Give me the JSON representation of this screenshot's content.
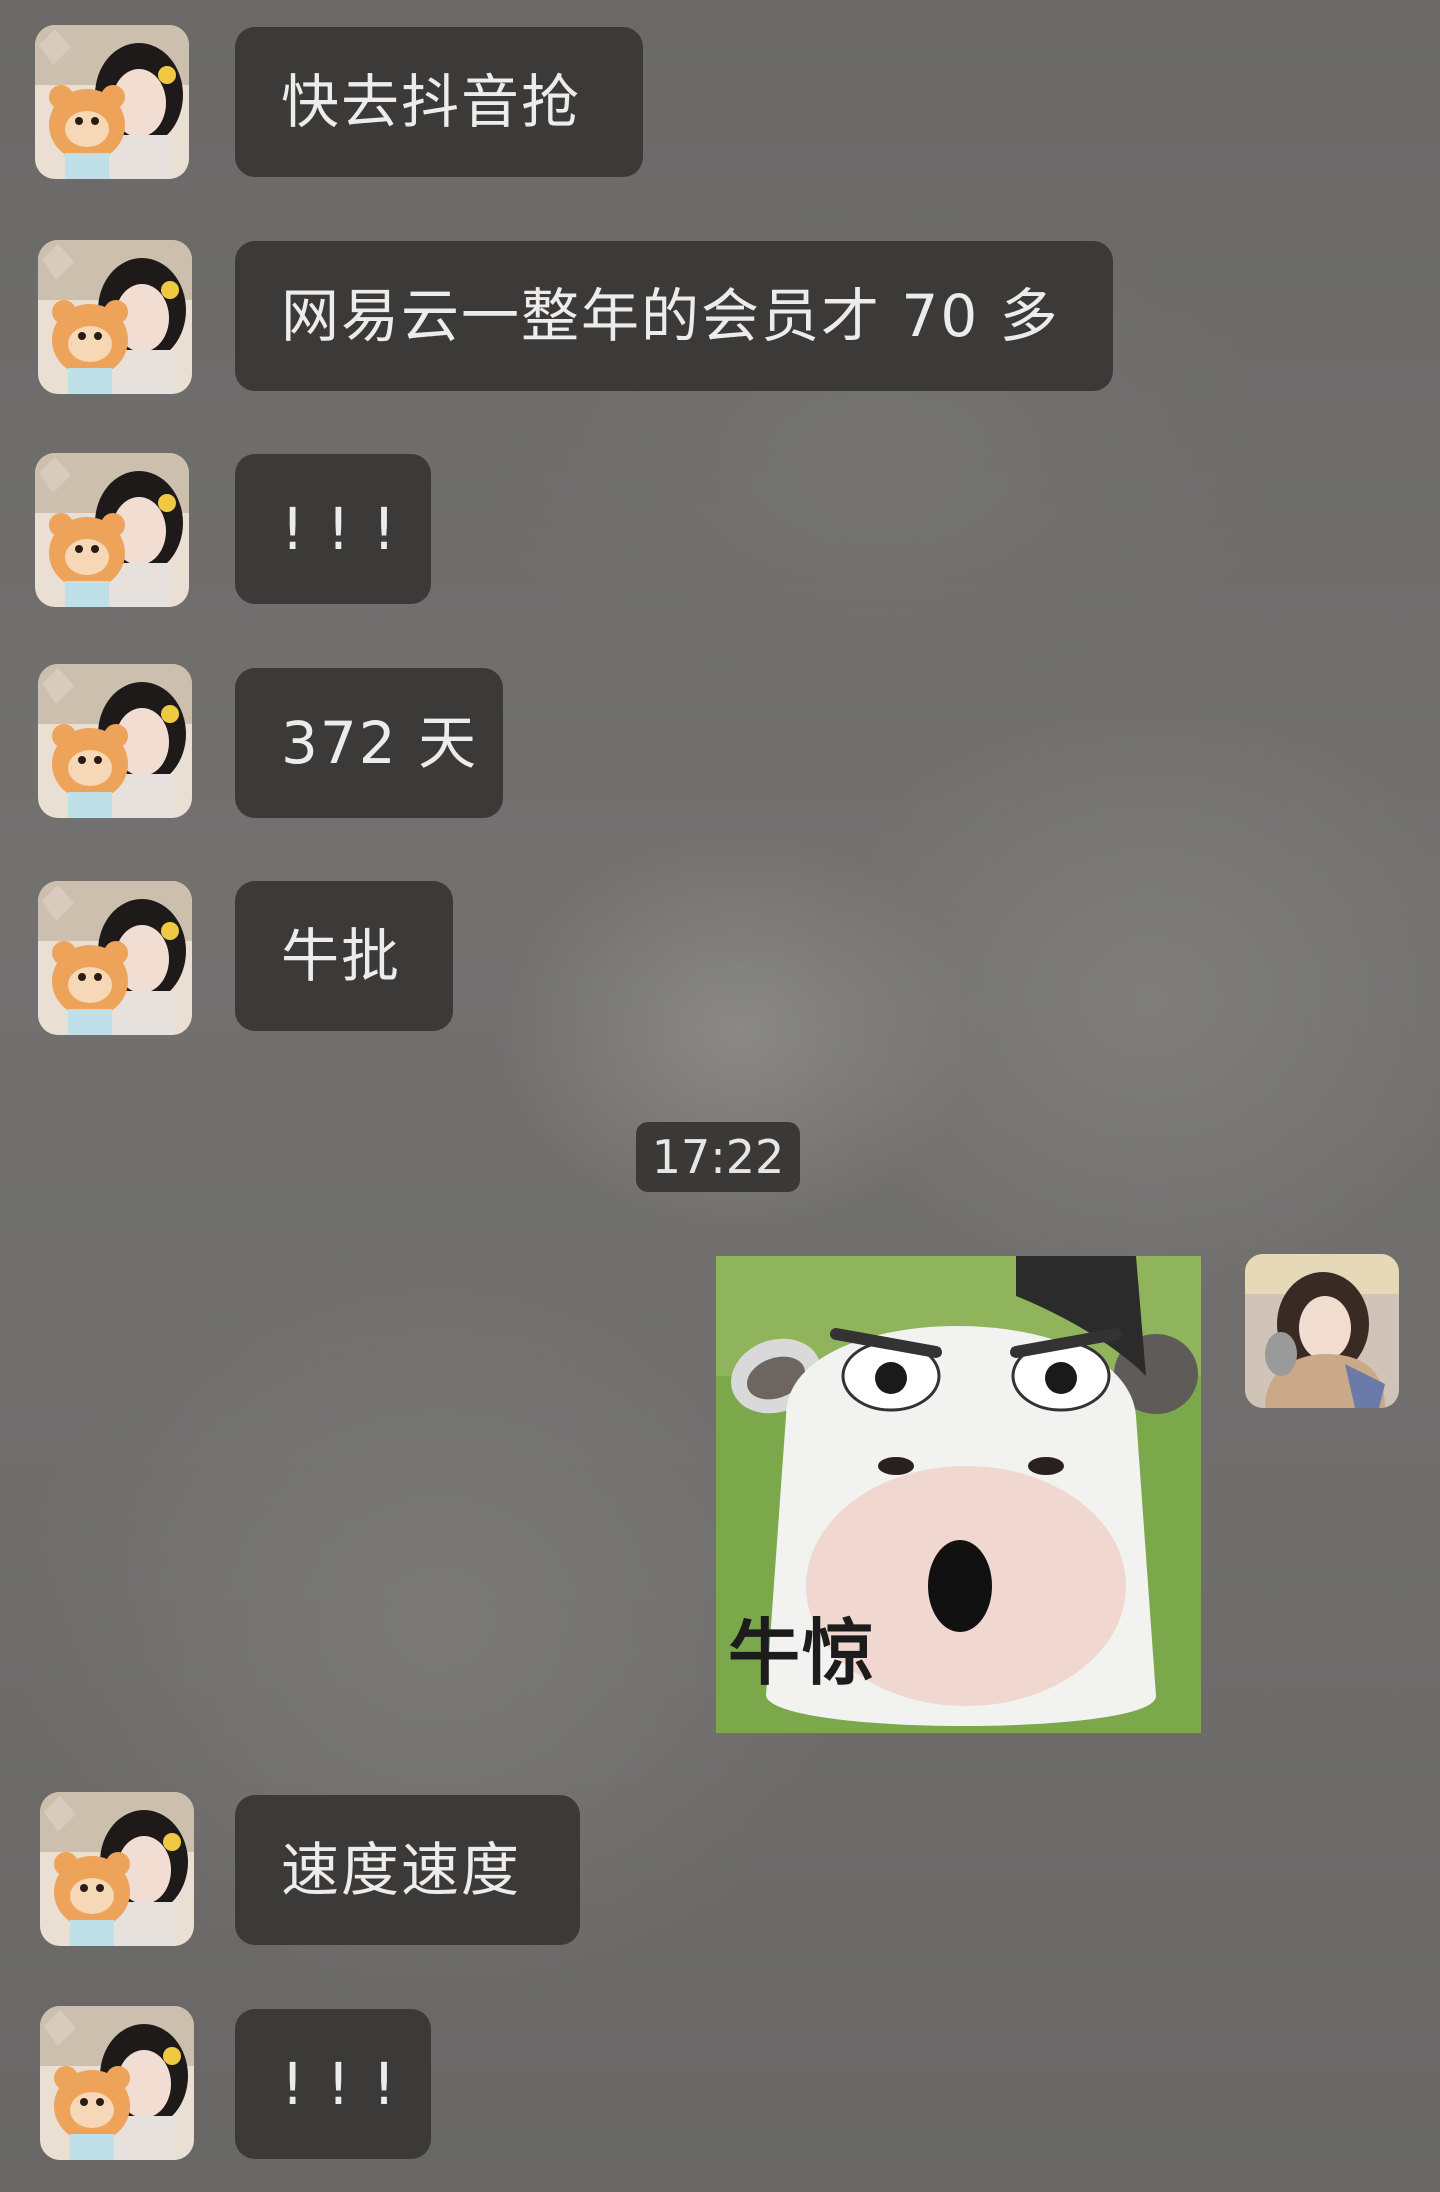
{
  "chat": {
    "messages": [
      {
        "sender": "other",
        "text": "快去抖音抢"
      },
      {
        "sender": "other",
        "text": "网易云一整年的会员才 70 多"
      },
      {
        "sender": "other",
        "text": "! ! !"
      },
      {
        "sender": "other",
        "text": "372 天"
      },
      {
        "sender": "other",
        "text": "牛批"
      },
      {
        "sender": "other",
        "text": "速度速度"
      },
      {
        "sender": "other",
        "text": "! ! !"
      }
    ],
    "timestamp": "17:22",
    "sticker": {
      "caption": "牛惊",
      "icon": "cow-sticker"
    }
  },
  "colors": {
    "bubble": "#3b3a39",
    "bubble_text": "#ececec",
    "timestamp_bg": "#3a3938"
  }
}
